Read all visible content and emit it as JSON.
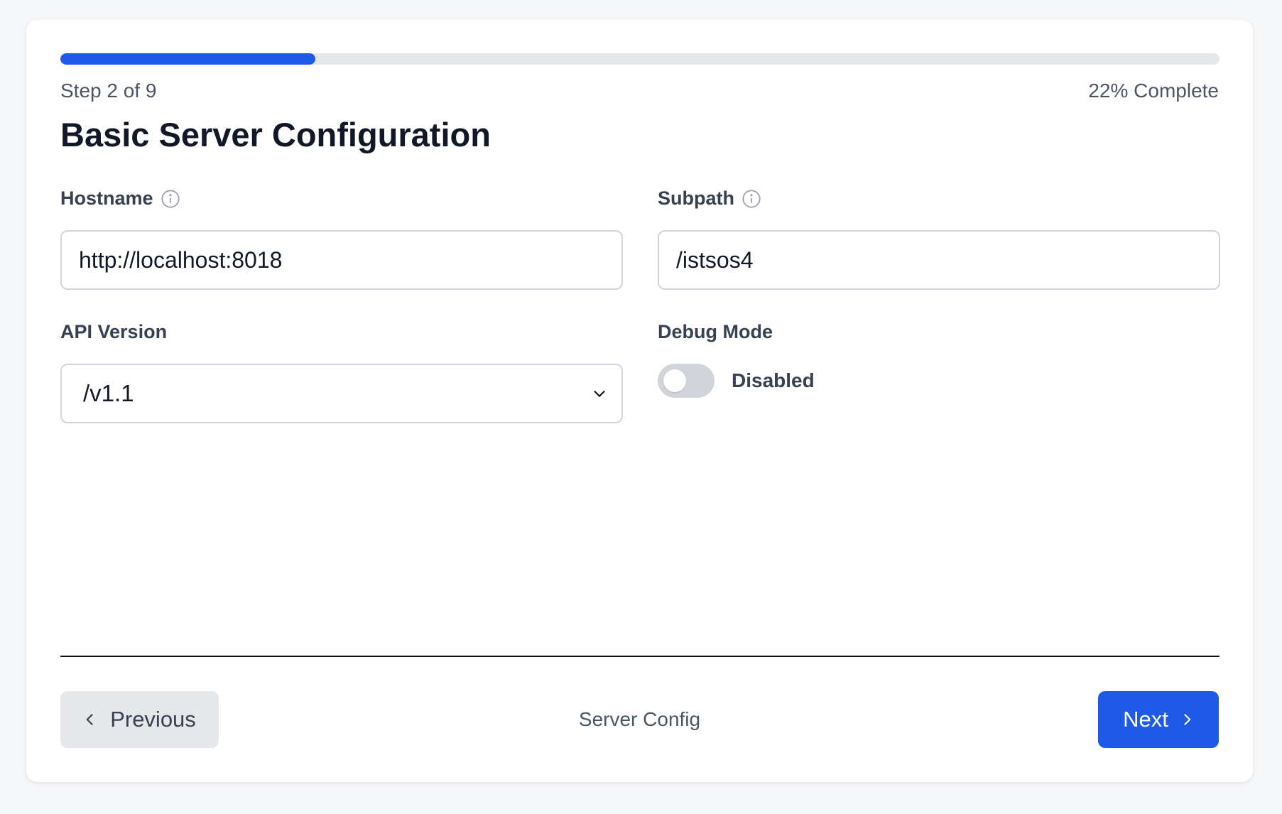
{
  "progress": {
    "fraction": 0.22,
    "step_label": "Step 2 of 9",
    "percent_label": "22% Complete",
    "fill_color": "#1d5ae8"
  },
  "page_title": "Basic Server Configuration",
  "fields": {
    "hostname": {
      "label": "Hostname",
      "value": "http://localhost:8018",
      "icon": "info-icon"
    },
    "subpath": {
      "label": "Subpath",
      "value": "/istsos4",
      "icon": "info-icon"
    },
    "api_version": {
      "label": "API Version",
      "selected": "/v1.1",
      "icon": "chevron-down-icon"
    },
    "debug_mode": {
      "label": "Debug Mode",
      "enabled": false,
      "state_text": "Disabled"
    }
  },
  "footer": {
    "previous_label": "Previous",
    "step_name": "Server Config",
    "next_label": "Next",
    "previous_icon": "chevron-left-icon",
    "next_icon": "chevron-right-icon"
  }
}
